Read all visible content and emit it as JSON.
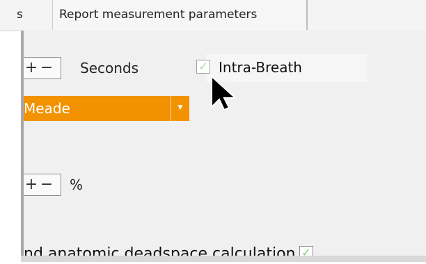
{
  "tabs": [
    {
      "label": "s"
    },
    {
      "label": "Report measurement parameters"
    }
  ],
  "settings": {
    "seconds_stepper": {
      "increment_symbol": "+",
      "decrement_symbol": "−",
      "unit": "Seconds"
    },
    "intra_breath": {
      "label": "Intra-Breath",
      "checked": true
    },
    "method_dropdown": {
      "selected": "Meade"
    },
    "percent_stepper": {
      "increment_symbol": "+",
      "decrement_symbol": "−",
      "unit": "%"
    },
    "deadspace": {
      "label": "nd anatomic deadspace calculation",
      "checked": true
    }
  },
  "colors": {
    "accent": "#f39200",
    "check": "#7ad06e"
  },
  "icons": {
    "dropdown_arrow": "caret-down",
    "check": "checkmark",
    "cursor": "mouse-pointer"
  }
}
